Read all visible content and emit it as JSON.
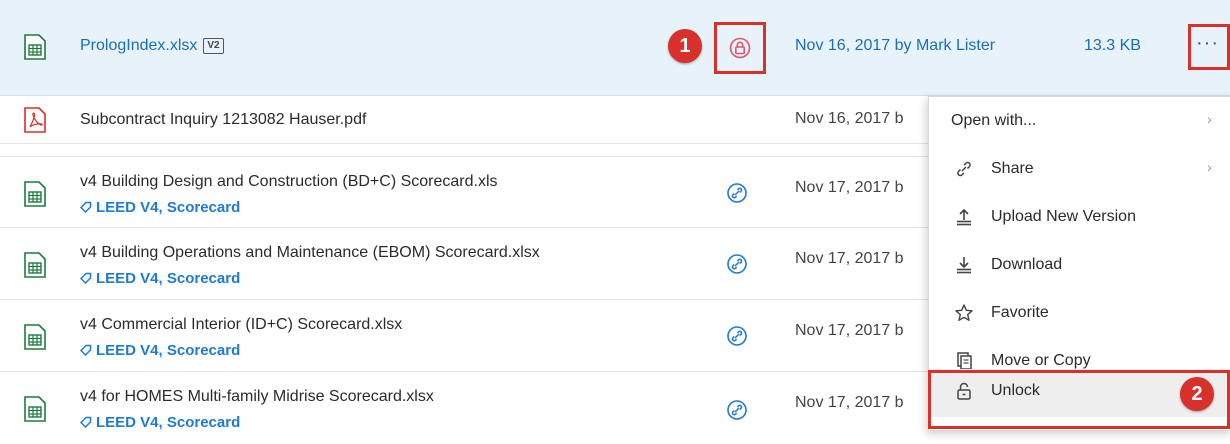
{
  "files": [
    {
      "name": "PrologIndex.xlsx",
      "version": "V2",
      "modified": "Nov 16, 2017 by Mark Lister",
      "size": "13.3 KB",
      "type": "xlsx"
    },
    {
      "name": "Subcontract Inquiry 1213082 Hauser.pdf",
      "modified": "Nov 16, 2017 b",
      "type": "pdf"
    },
    {
      "name": "v4 Building Design and Construction (BD+C) Scorecard.xls",
      "tags": "LEED V4, Scorecard",
      "modified": "Nov 17, 2017 b",
      "type": "xls"
    },
    {
      "name": "v4 Building Operations and Maintenance (EBOM) Scorecard.xlsx",
      "tags": "LEED V4, Scorecard",
      "modified": "Nov 17, 2017 b",
      "type": "xlsx"
    },
    {
      "name": "v4 Commercial Interior (ID+C) Scorecard.xlsx",
      "tags": "LEED V4, Scorecard",
      "modified": "Nov 17, 2017 b",
      "type": "xlsx"
    },
    {
      "name": "v4 for HOMES Multi-family Midrise Scorecard.xlsx",
      "tags": "LEED V4, Scorecard",
      "modified": "Nov 17, 2017 b",
      "type": "xlsx"
    }
  ],
  "more_button": "···",
  "context_menu": {
    "items": [
      {
        "label": "Open with...",
        "icon": "none",
        "submenu": true
      },
      {
        "label": "Share",
        "icon": "link-icon",
        "submenu": true
      },
      {
        "label": "Upload New Version",
        "icon": "upload-icon"
      },
      {
        "label": "Download",
        "icon": "download-icon"
      },
      {
        "label": "Favorite",
        "icon": "star-icon"
      },
      {
        "label": "Move or Copy",
        "icon": "copy-icon"
      },
      {
        "label": "Unlock",
        "icon": "unlock-icon"
      }
    ],
    "submenu_arrow": "›"
  },
  "callouts": [
    "1",
    "2"
  ],
  "colors": {
    "accent": "#1a6fb5",
    "callout": "#d8302b",
    "lock": "#e0566b",
    "selected_row": "#e8f2fb",
    "excel": "#1e7a3c",
    "pdf": "#d93025"
  }
}
